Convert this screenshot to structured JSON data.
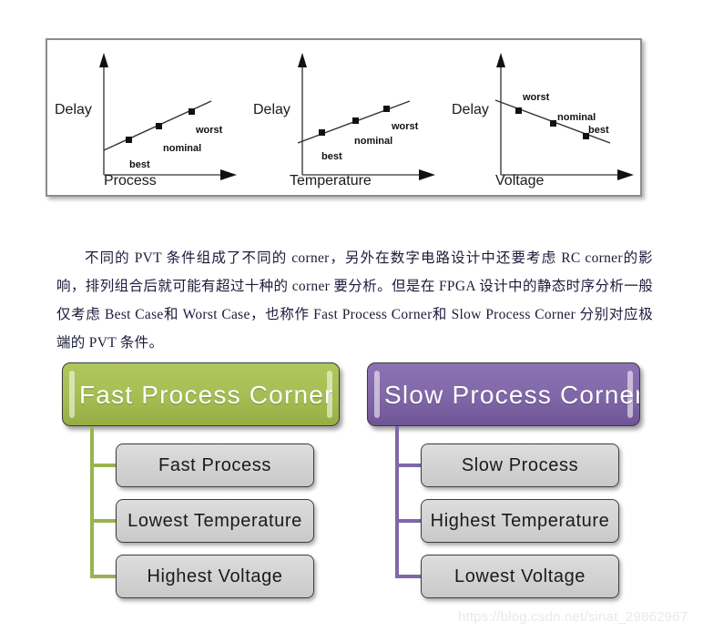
{
  "figure": {
    "charts": [
      {
        "ylabel": "Delay",
        "xlabel": "Process",
        "points": [
          {
            "label": "best"
          },
          {
            "label": "nominal"
          },
          {
            "label": "worst"
          }
        ]
      },
      {
        "ylabel": "Delay",
        "xlabel": "Temperature",
        "points": [
          {
            "label": "best"
          },
          {
            "label": "nominal"
          },
          {
            "label": "worst"
          }
        ]
      },
      {
        "ylabel": "Delay",
        "xlabel": "Voltage",
        "points": [
          {
            "label": "worst"
          },
          {
            "label": "nominal"
          },
          {
            "label": "best"
          }
        ]
      }
    ]
  },
  "chart_data": [
    {
      "type": "line",
      "title": "",
      "xlabel": "Process",
      "ylabel": "Delay",
      "x": [
        0.3,
        0.55,
        0.78
      ],
      "y": [
        0.38,
        0.52,
        0.67
      ],
      "point_labels": [
        "best",
        "nominal",
        "worst"
      ],
      "trend": "increasing",
      "xlim": [
        0,
        1
      ],
      "ylim": [
        0,
        1
      ],
      "grid": false,
      "legend": "none",
      "axis_arrows": true,
      "tick_labels": []
    },
    {
      "type": "line",
      "title": "",
      "xlabel": "Temperature",
      "ylabel": "Delay",
      "x": [
        0.3,
        0.55,
        0.78
      ],
      "y": [
        0.38,
        0.52,
        0.67
      ],
      "point_labels": [
        "best",
        "nominal",
        "worst"
      ],
      "trend": "increasing",
      "xlim": [
        0,
        1
      ],
      "ylim": [
        0,
        1
      ],
      "grid": false,
      "legend": "none",
      "axis_arrows": true,
      "tick_labels": []
    },
    {
      "type": "line",
      "title": "",
      "xlabel": "Voltage",
      "ylabel": "Delay",
      "x": [
        0.22,
        0.52,
        0.78
      ],
      "y": [
        0.66,
        0.55,
        0.44
      ],
      "point_labels": [
        "worst",
        "nominal",
        "best"
      ],
      "trend": "decreasing",
      "xlim": [
        0,
        1
      ],
      "ylim": [
        0,
        1
      ],
      "grid": false,
      "legend": "none",
      "axis_arrows": true,
      "tick_labels": []
    }
  ],
  "paragraph": {
    "text": "不同的 PVT 条件组成了不同的 corner，另外在数字电路设计中还要考虑 RC  corner的影响，排列组合后就可能有超过十种的 corner 要分析。但是在 FPGA 设计中的静态时序分析一般仅考虑 Best  Case和 Worst  Case，也称作 Fast  Process  Corner和 Slow  Process  Corner 分别对应极端的 PVT 条件。"
  },
  "trees": {
    "left": {
      "header": "Fast  Process  Corner",
      "header_color": "#a5bd52",
      "accent_color": "#9ab34e",
      "leaves": [
        "Fast  Process",
        "Lowest  Temperature",
        "Highest  Voltage"
      ]
    },
    "right": {
      "header": "Slow  Process  Corner",
      "header_color": "#8067a8",
      "accent_color": "#8067a8",
      "leaves": [
        "Slow  Process",
        "Highest  Temperature",
        "Lowest  Voltage"
      ]
    }
  },
  "watermark": {
    "text": "https://blog.csdn.net/sinat_29862967"
  }
}
